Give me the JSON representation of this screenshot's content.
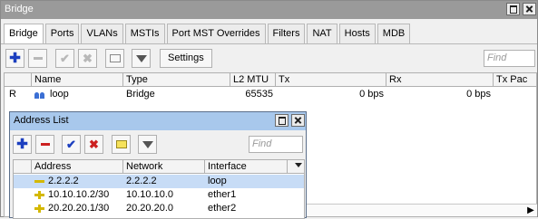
{
  "window": {
    "title": "Bridge"
  },
  "tabs": [
    {
      "label": "Bridge",
      "active": true
    },
    {
      "label": "Ports"
    },
    {
      "label": "VLANs"
    },
    {
      "label": "MSTIs"
    },
    {
      "label": "Port MST Overrides"
    },
    {
      "label": "Filters"
    },
    {
      "label": "NAT"
    },
    {
      "label": "Hosts"
    },
    {
      "label": "MDB"
    }
  ],
  "toolbar": {
    "settings_label": "Settings",
    "find_placeholder": "Find"
  },
  "table": {
    "columns": [
      "Name",
      "Type",
      "L2 MTU",
      "Tx",
      "Rx",
      "Tx Pac"
    ],
    "rows": [
      {
        "flag": "R",
        "name": "loop",
        "type": "Bridge",
        "l2mtu": "65535",
        "tx": "0 bps",
        "rx": "0 bps"
      }
    ]
  },
  "address_list": {
    "title": "Address List",
    "find_placeholder": "Find",
    "columns": [
      "Address",
      "Network",
      "Interface"
    ],
    "rows": [
      {
        "address": "2.2.2.2",
        "network": "2.2.2.2",
        "interface": "loop",
        "selected": true
      },
      {
        "address": "10.10.10.2/30",
        "network": "10.10.10.0",
        "interface": "ether1"
      },
      {
        "address": "20.20.20.1/30",
        "network": "20.20.20.0",
        "interface": "ether2"
      }
    ]
  },
  "colors": {
    "accent": "#1c3fbf",
    "selection": "#c7dcf6",
    "subtitle_bar": "#a8c8ec"
  }
}
